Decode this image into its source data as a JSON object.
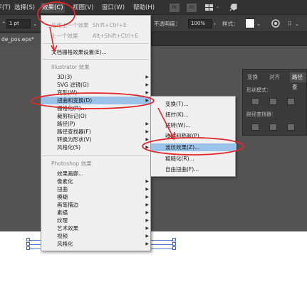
{
  "menubar": {
    "items": [
      {
        "label": "文字(T)"
      },
      {
        "label": "选择(S)"
      },
      {
        "label": "效果(C)"
      },
      {
        "label": "视图(V)"
      },
      {
        "label": "窗口(W)"
      },
      {
        "label": "帮助(H)"
      }
    ],
    "app_icons": [
      "Br",
      "St"
    ]
  },
  "controlbar": {
    "stroke_value": "1 pt",
    "opacity_label": "不透明度：",
    "opacity_value": "100%",
    "style_label": "样式："
  },
  "document_tab": {
    "title": "de_pos.eps*"
  },
  "effect_menu": {
    "apply_last": {
      "label": "应用上一个效果",
      "shortcut": "Shift+Ctrl+E"
    },
    "last_effect": {
      "label": "上一个效果",
      "shortcut": "Alt+Shift+Ctrl+E"
    },
    "raster_settings": "文档栅格效果设置(E)...",
    "illustrator_header": "Illustrator 效果",
    "illustrator_items": [
      "3D(3)",
      "SVG 滤镜(G)",
      "变形(W)",
      "扭曲和变换(D)",
      "栅格化(R)...",
      "裁剪标记(O)",
      "路径(P)",
      "路径查找器(F)",
      "转换为形状(V)",
      "风格化(S)"
    ],
    "photoshop_header": "Photoshop 效果",
    "photoshop_items": [
      "效果画廊...",
      "像素化",
      "扭曲",
      "模糊",
      "画笔描边",
      "素描",
      "纹理",
      "艺术效果",
      "视频",
      "风格化"
    ]
  },
  "distort_submenu": {
    "items": [
      "变换(T)...",
      "扭拧(K)...",
      "扭转(W)...",
      "收缩和膨胀(P)...",
      "波纹效果(Z)...",
      "粗糙化(R)...",
      "自由扭曲(F)..."
    ],
    "highlighted": "波纹效果(Z)..."
  },
  "right_panel": {
    "tabs": [
      "变换",
      "对齐",
      "路径查"
    ],
    "shape_modes_label": "形状模式：",
    "pathfinder_label": "路径查找器："
  },
  "colors": {
    "annotation_red": "#e5262a",
    "menu_highlight": "#9bc3ea",
    "ui_dark": "#323232"
  }
}
